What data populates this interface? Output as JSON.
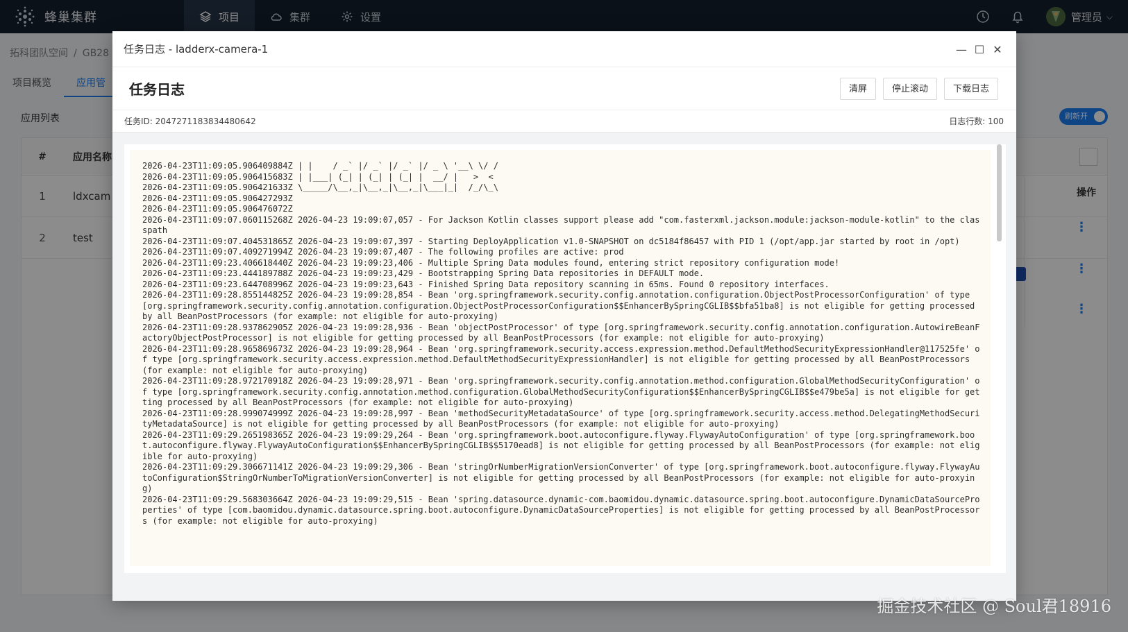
{
  "app": {
    "brand": "蜂巢集群",
    "nav": [
      {
        "label": "项目",
        "icon": "layers-icon"
      },
      {
        "label": "集群",
        "icon": "cloud-icon"
      },
      {
        "label": "设置",
        "icon": "gear-icon"
      }
    ],
    "user": "管理员"
  },
  "page": {
    "breadcrumb": [
      "拓科团队空间",
      "GB28"
    ],
    "tabs": [
      "项目概览",
      "应用管"
    ],
    "section_title": "应用列表",
    "toggle_label": "刷新开",
    "table": {
      "headers": [
        "#",
        "应用名称"
      ],
      "ops_header": "操作",
      "rows": [
        {
          "idx": "1",
          "name": "ldxcam"
        },
        {
          "idx": "2",
          "name": "test"
        }
      ]
    }
  },
  "modal": {
    "window_title": "任务日志 - ladderx-camera-1",
    "heading": "任务日志",
    "buttons": {
      "clear": "清屏",
      "stop_scroll": "停止滚动",
      "download": "下载日志"
    },
    "task_id": "任务ID: 2047271183834480642",
    "line_count": "日志行数: 100",
    "log_lines": [
      "2026-04-23T11:09:05.906409884Z | |    / _` |/ _` |/ _` |/ _ \\ '__\\ \\/ /",
      "2026-04-23T11:09:05.906415683Z | |___| (_| | (_| | (_| |  __/ |   >  <",
      "2026-04-23T11:09:05.906421633Z \\_____/\\__,_|\\__,_|\\__,_|\\___|_|  /_/\\_\\",
      "2026-04-23T11:09:05.906427293Z",
      "2026-04-23T11:09:05.906476072Z",
      "2026-04-23T11:09:07.060115268Z 2026-04-23 19:09:07,057 - For Jackson Kotlin classes support please add \"com.fasterxml.jackson.module:jackson-module-kotlin\" to the classpath",
      "2026-04-23T11:09:07.404531865Z 2026-04-23 19:09:07,397 - Starting DeployApplication v1.0-SNAPSHOT on dc5184f86457 with PID 1 (/opt/app.jar started by root in /opt)",
      "2026-04-23T11:09:07.409271994Z 2026-04-23 19:09:07,407 - The following profiles are active: prod",
      "2026-04-23T11:09:23.406618440Z 2026-04-23 19:09:23,406 - Multiple Spring Data modules found, entering strict repository configuration mode!",
      "2026-04-23T11:09:23.444189788Z 2026-04-23 19:09:23,429 - Bootstrapping Spring Data repositories in DEFAULT mode.",
      "2026-04-23T11:09:23.644708996Z 2026-04-23 19:09:23,643 - Finished Spring Data repository scanning in 65ms. Found 0 repository interfaces.",
      "2026-04-23T11:09:28.855144825Z 2026-04-23 19:09:28,854 - Bean 'org.springframework.security.config.annotation.configuration.ObjectPostProcessorConfiguration' of type [org.springframework.security.config.annotation.configuration.ObjectPostProcessorConfiguration$$EnhancerBySpringCGLIB$$bfa51ba8] is not eligible for getting processed by all BeanPostProcessors (for example: not eligible for auto-proxying)",
      "2026-04-23T11:09:28.937862905Z 2026-04-23 19:09:28,936 - Bean 'objectPostProcessor' of type [org.springframework.security.config.annotation.configuration.AutowireBeanFactoryObjectPostProcessor] is not eligible for getting processed by all BeanPostProcessors (for example: not eligible for auto-proxying)",
      "2026-04-23T11:09:28.965869673Z 2026-04-23 19:09:28,964 - Bean 'org.springframework.security.access.expression.method.DefaultMethodSecurityExpressionHandler@117525fe' of type [org.springframework.security.access.expression.method.DefaultMethodSecurityExpressionHandler] is not eligible for getting processed by all BeanPostProcessors (for example: not eligible for auto-proxying)",
      "2026-04-23T11:09:28.972170918Z 2026-04-23 19:09:28,971 - Bean 'org.springframework.security.config.annotation.method.configuration.GlobalMethodSecurityConfiguration' of type [org.springframework.security.config.annotation.method.configuration.GlobalMethodSecurityConfiguration$$EnhancerBySpringCGLIB$$e479be5a] is not eligible for getting processed by all BeanPostProcessors (for example: not eligible for auto-proxying)",
      "2026-04-23T11:09:28.999074999Z 2026-04-23 19:09:28,997 - Bean 'methodSecurityMetadataSource' of type [org.springframework.security.access.method.DelegatingMethodSecurityMetadataSource] is not eligible for getting processed by all BeanPostProcessors (for example: not eligible for auto-proxying)",
      "2026-04-23T11:09:29.265198365Z 2026-04-23 19:09:29,264 - Bean 'org.springframework.boot.autoconfigure.flyway.FlywayAutoConfiguration' of type [org.springframework.boot.autoconfigure.flyway.FlywayAutoConfiguration$$EnhancerBySpringCGLIB$$5170ead8] is not eligible for getting processed by all BeanPostProcessors (for example: not eligible for auto-proxying)",
      "2026-04-23T11:09:29.306671141Z 2026-04-23 19:09:29,306 - Bean 'stringOrNumberMigrationVersionConverter' of type [org.springframework.boot.autoconfigure.flyway.FlywayAutoConfiguration$StringOrNumberToMigrationVersionConverter] is not eligible for getting processed by all BeanPostProcessors (for example: not eligible for auto-proxying)",
      "2026-04-23T11:09:29.568303664Z 2026-04-23 19:09:29,515 - Bean 'spring.datasource.dynamic-com.baomidou.dynamic.datasource.spring.boot.autoconfigure.DynamicDataSourceProperties' of type [com.baomidou.dynamic.datasource.spring.boot.autoconfigure.DynamicDataSourceProperties] is not eligible for getting processed by all BeanPostProcessors (for example: not eligible for auto-proxying)"
    ]
  },
  "watermark": "掘金技术社区 @ Soul君18916"
}
